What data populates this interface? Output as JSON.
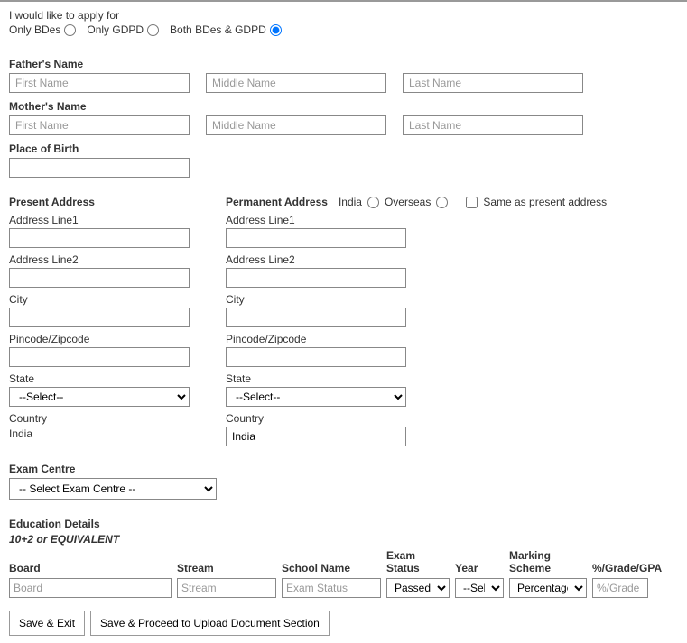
{
  "apply": {
    "prompt": "I would like to apply for",
    "options": {
      "only_bdes": "Only BDes",
      "only_gdpd": "Only GDPD",
      "both": "Both BDes & GDPD"
    }
  },
  "father": {
    "label": "Father's Name",
    "first_ph": "First Name",
    "middle_ph": "Middle Name",
    "last_ph": "Last Name"
  },
  "mother": {
    "label": "Mother's Name",
    "first_ph": "First Name",
    "middle_ph": "Middle Name",
    "last_ph": "Last Name"
  },
  "pob": {
    "label": "Place of Birth"
  },
  "present": {
    "header": "Present Address",
    "line1": "Address Line1",
    "line2": "Address Line2",
    "city": "City",
    "pin": "Pincode/Zipcode",
    "state": "State",
    "state_default": "--Select--",
    "country": "Country",
    "country_value": "India"
  },
  "permanent": {
    "header": "Permanent Address",
    "india": "India",
    "overseas": "Overseas",
    "same": "Same as present address",
    "line1": "Address Line1",
    "line2": "Address Line2",
    "city": "City",
    "pin": "Pincode/Zipcode",
    "state": "State",
    "state_default": "--Select--",
    "country": "Country",
    "country_value": "India"
  },
  "exam": {
    "label": "Exam Centre",
    "default": "-- Select Exam Centre --"
  },
  "edu": {
    "header": "Education Details",
    "sub": "10+2 or EQUIVALENT",
    "cols": {
      "board": "Board",
      "stream": "Stream",
      "school": "School Name",
      "exam": "Exam Status",
      "year": "Year",
      "mark": "Marking Scheme",
      "grade": "%/Grade/GPA"
    },
    "ph": {
      "board": "Board",
      "stream": "Stream",
      "school": "Exam Status",
      "exam_default": "Passed",
      "year_default": "--Select Year--",
      "mark_default": "Percentage",
      "grade": "%/Grade"
    }
  },
  "buttons": {
    "save_exit": "Save & Exit",
    "save_proceed": "Save & Proceed to Upload Document Section"
  }
}
